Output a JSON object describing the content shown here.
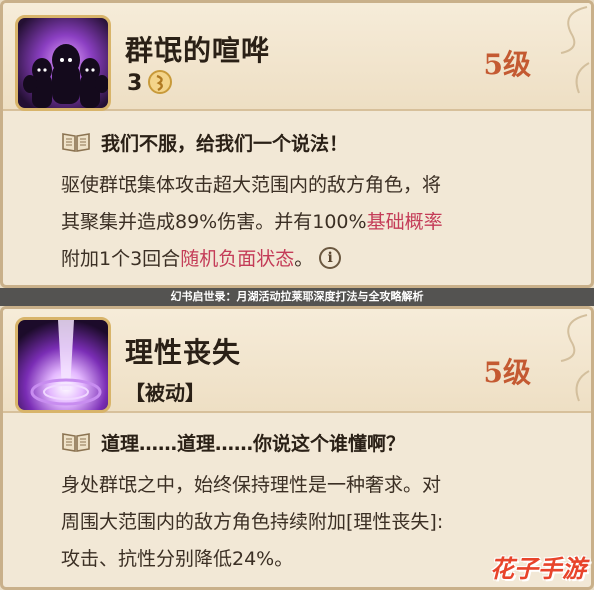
{
  "banner": {
    "text": "幻书启世录：月湖活动拉莱耶深度打法与全攻略解析"
  },
  "skills": [
    {
      "name": "群氓的喧哗",
      "cost": "3",
      "level": "5级",
      "quote": "我们不服，给我们一个说法！",
      "desc_lines": [
        {
          "a": "驱使群氓集体攻击超大范围内的敌方角色，将",
          "hl": "",
          "b": ""
        },
        {
          "a": "其聚集并造成89%伤害。并有100%",
          "hl": "基础概率",
          "b": ""
        },
        {
          "a": "附加1个3回合",
          "hl": "随机负面状态",
          "b": "。"
        }
      ],
      "icons": {
        "skill": "shadow-crowd-icon",
        "cost": "energy-orb-icon",
        "info": "info-icon",
        "book": "book-icon"
      }
    },
    {
      "name": "理性丧失",
      "tag": "【被动】",
      "level": "5级",
      "quote": "道理……道理……你说这个谁懂啊？",
      "desc_lines": [
        {
          "a": "身处群氓之中，始终保持理性是一种奢求。对"
        },
        {
          "a": "周围大范围内的敌方角色持续附加[理性丧失]:"
        },
        {
          "a": "攻击、抗性分别降低24%。"
        }
      ],
      "icons": {
        "skill": "purple-vortex-icon",
        "book": "book-icon"
      }
    }
  ],
  "watermark": {
    "text": "花子手游"
  },
  "colors": {
    "level": "#c45a32",
    "highlight": "#c43c58",
    "parchment": "#f2e8d6",
    "border": "#c9b08a"
  }
}
